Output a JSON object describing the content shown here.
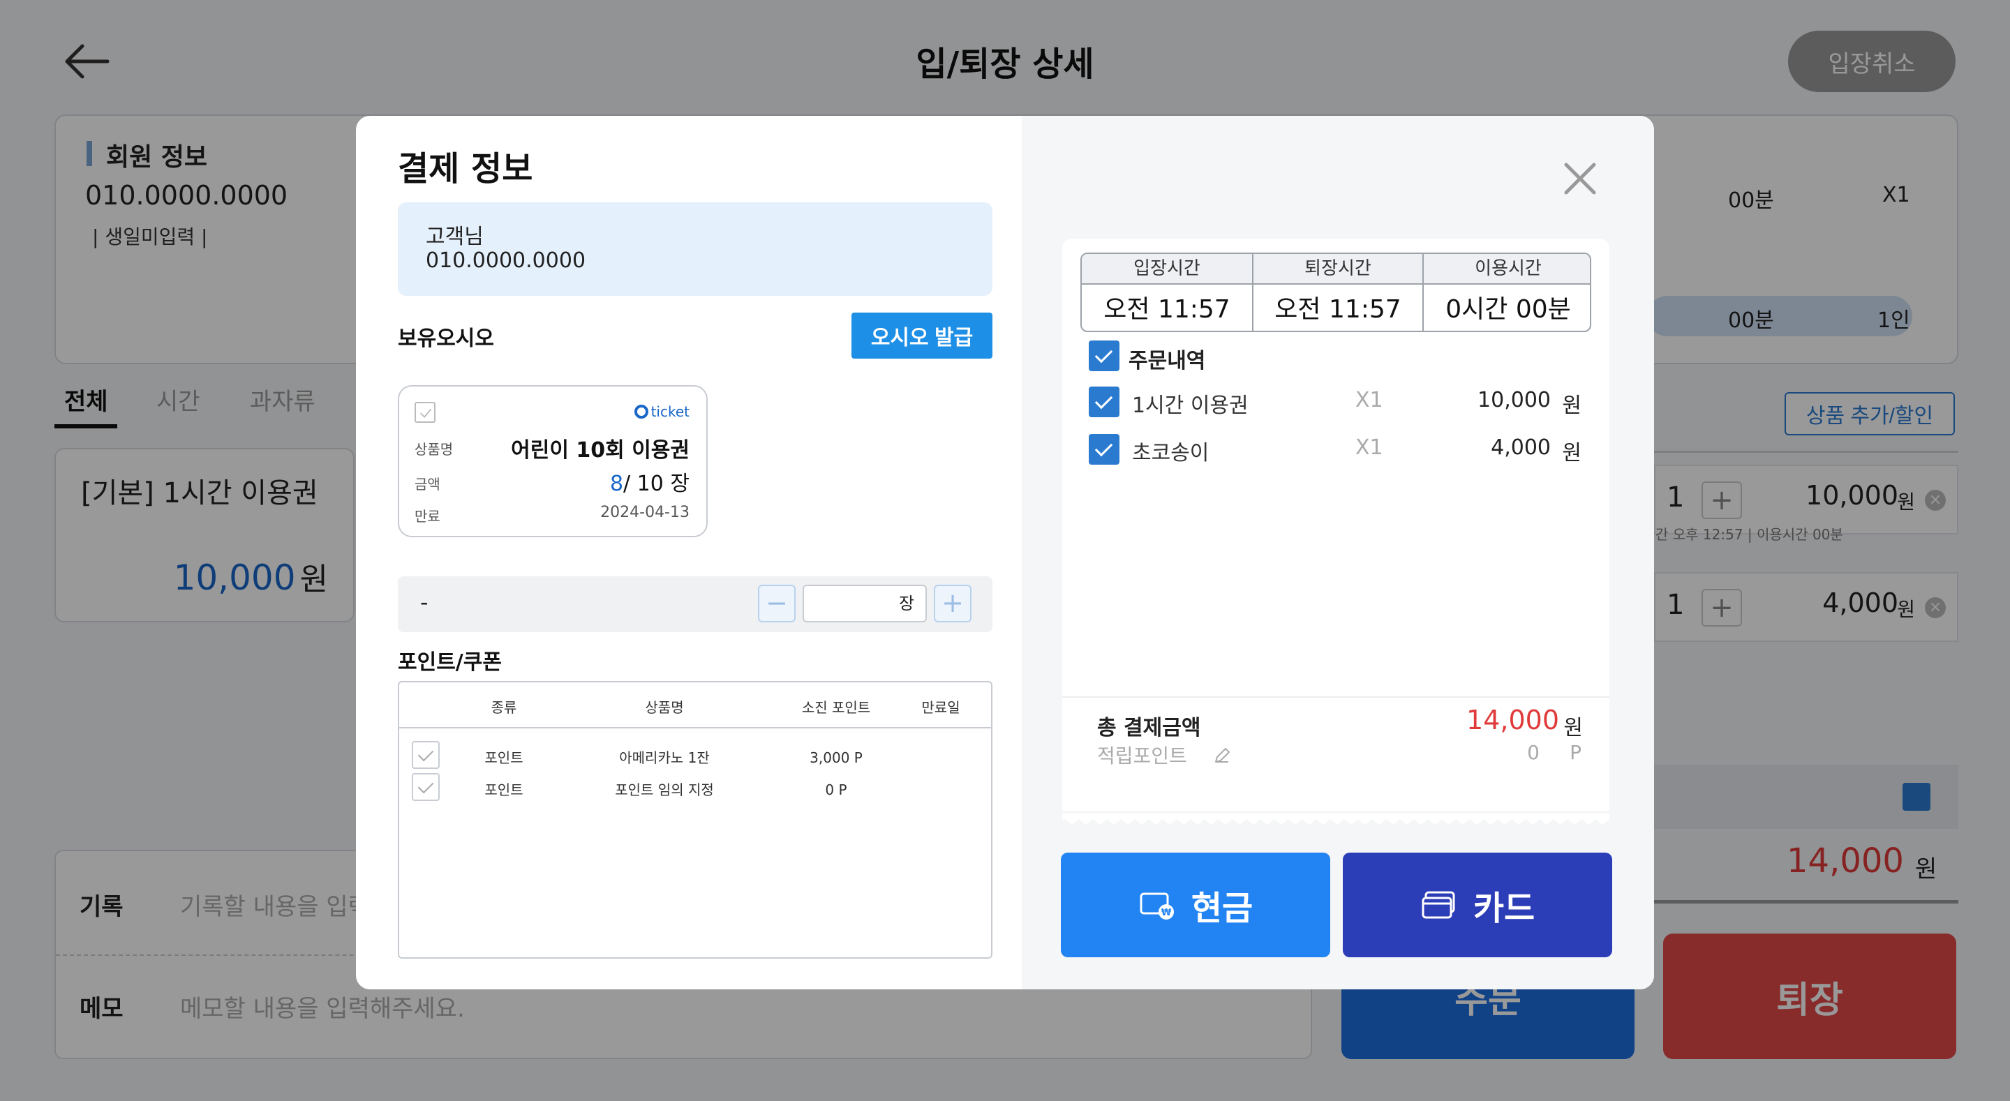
{
  "header": {
    "title": "입/퇴장 상세",
    "cancel_entry_label": "입장취소"
  },
  "member": {
    "title": "회원 정보",
    "phone": "010.0000.0000",
    "birth": "| 생일미입력 |",
    "right_minutes": "00분",
    "right_count": "X1",
    "right_minutes2": "00분",
    "right_people": "1인"
  },
  "tabs": [
    {
      "label": "전체"
    },
    {
      "label": "시간"
    },
    {
      "label": "과자류"
    }
  ],
  "bg_product": {
    "name_prefix": "[기본]",
    "name": "1시간 이용권",
    "price": "10,000",
    "unit": "원"
  },
  "bg_order": {
    "add_label": "상품 추가/할인",
    "rows": [
      {
        "qty": "1",
        "plus": "+",
        "price": "10,000",
        "unit": "원",
        "sub": "간  오후 12:57 | 이용시간  00분"
      },
      {
        "qty": "1",
        "plus": "+",
        "price": "4,000",
        "unit": "원",
        "sub": ""
      }
    ],
    "total": "14,000",
    "total_unit": "원"
  },
  "memo": {
    "record_label": "기록",
    "record_placeholder": "기록할 내용을 입력",
    "memo_label": "메모",
    "memo_placeholder": "메모할 내용을 입력해주세요."
  },
  "bg_buttons": {
    "order": "주문",
    "exit": "퇴장"
  },
  "modal": {
    "title": "결제 정보",
    "customer_name": "고객님",
    "customer_phone": "010.0000.0000",
    "owned_label": "보유오시오",
    "issue_label": "오시오 발급",
    "ticket": {
      "logo": "ticket",
      "name_label": "상품명",
      "name": "어린이 10회 이용권",
      "amount_label": "금액",
      "remaining": "8",
      "total": "/ 10 장",
      "expiry_label": "만료",
      "expiry": "2024-04-13"
    },
    "qty": {
      "dash": "-",
      "minus": "−",
      "unit": "장",
      "plus": "+"
    },
    "points_label": "포인트/쿠폰",
    "point_table": {
      "headers": [
        "종류",
        "상품명",
        "소진 포인트",
        "만료일"
      ],
      "rows": [
        {
          "type": "포인트",
          "name": "아메리카노 1잔",
          "points": "3,000 P",
          "expiry": ""
        },
        {
          "type": "포인트",
          "name": "포인트 임의 지정",
          "points": "0 P",
          "expiry": ""
        }
      ]
    },
    "time_table": {
      "headers": [
        "입장시간",
        "퇴장시간",
        "이용시간"
      ],
      "values": [
        "오전 11:57",
        "오전 11:57",
        "0시간 00분"
      ]
    },
    "order_head": "주문내역",
    "order_items": [
      {
        "name": "1시간 이용권",
        "qty": "X1",
        "price": "10,000",
        "unit": "원"
      },
      {
        "name": "초코송이",
        "qty": "X1",
        "price": "4,000",
        "unit": "원"
      }
    ],
    "total_label": "총 결제금액",
    "total_value": "14,000",
    "total_unit": "원",
    "point_label": "적립포인트",
    "point_value": "0",
    "point_unit": "P",
    "cash_label": "현금",
    "card_label": "카드"
  },
  "colors": {
    "primary_blue": "#2184f2",
    "card_navy": "#2c3db8",
    "total_red": "#e03a3a",
    "exit_red": "#e34848"
  }
}
